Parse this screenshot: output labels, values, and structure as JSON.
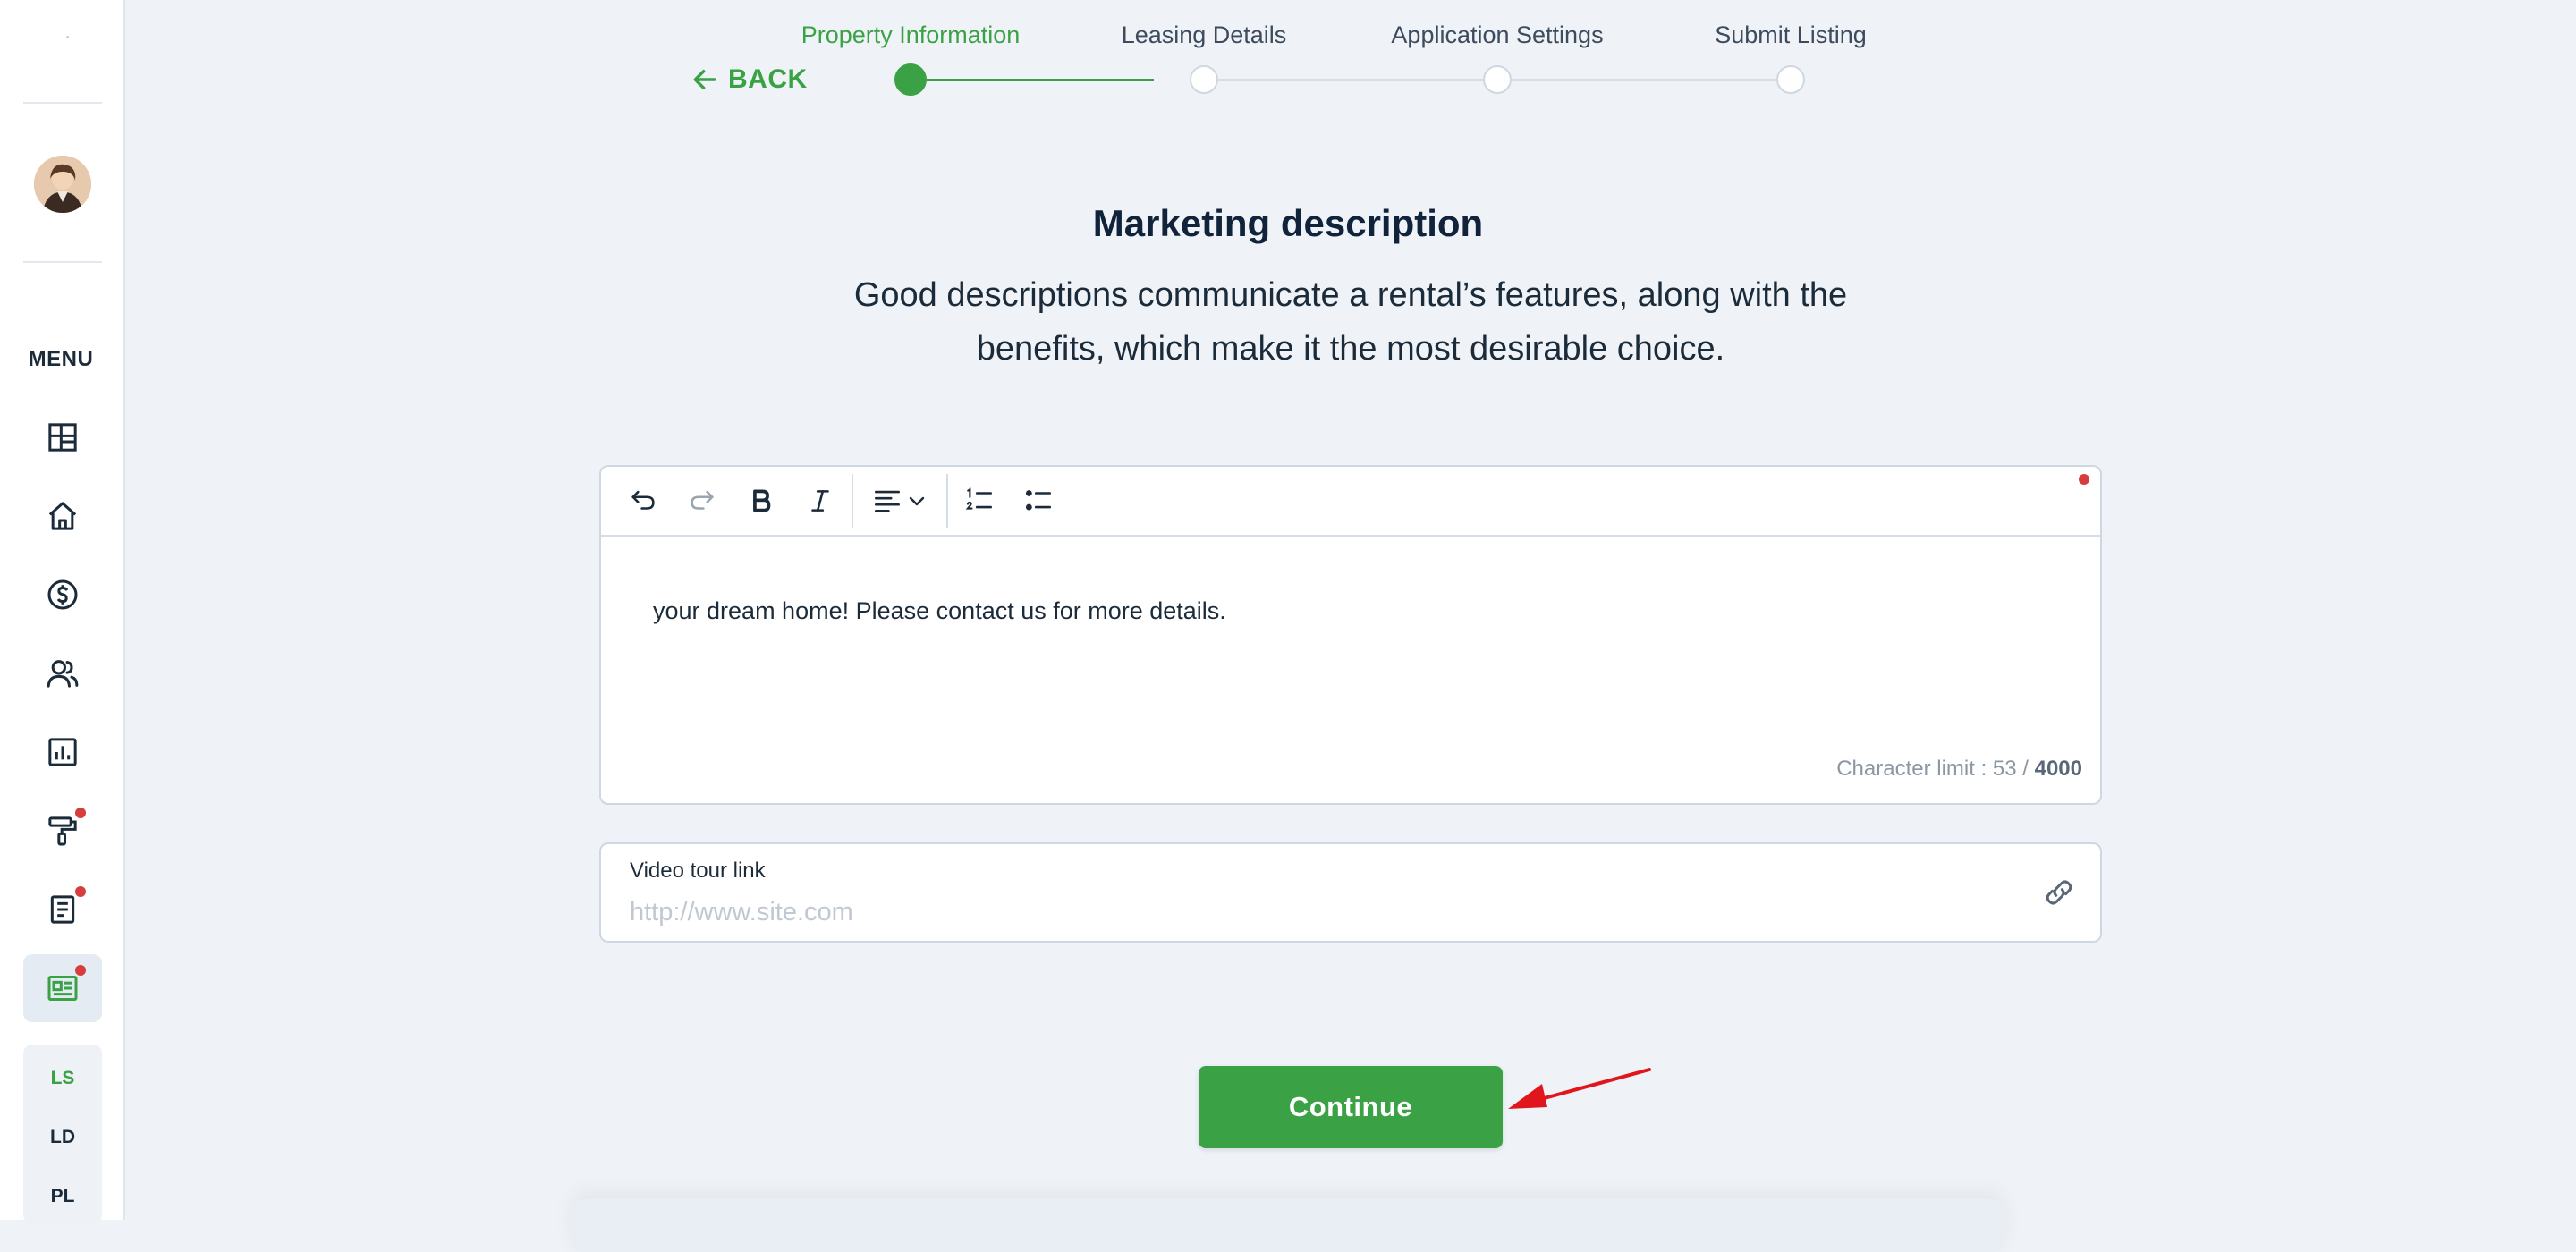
{
  "sidebar": {
    "menu_label": "MENU",
    "nav_icons": [
      "dashboard-icon",
      "home-icon",
      "dollar-icon",
      "users-icon",
      "chart-icon",
      "paint-roller-icon",
      "document-icon",
      "listing-icon"
    ],
    "sub_items": [
      {
        "label": "LS",
        "active": true
      },
      {
        "label": "LD",
        "active": false
      },
      {
        "label": "PL",
        "active": false
      }
    ]
  },
  "stepper": {
    "back_label": "BACK",
    "steps": [
      {
        "label": "Property Information",
        "state": "active"
      },
      {
        "label": "Leasing Details",
        "state": "pending"
      },
      {
        "label": "Application Settings",
        "state": "pending"
      },
      {
        "label": "Submit Listing",
        "state": "pending"
      }
    ]
  },
  "page": {
    "title": "Marketing description",
    "subtitle": "Good descriptions communicate a rental’s features, along with the benefits, which make it the most desirable choice."
  },
  "editor": {
    "toolbar": [
      "undo-icon",
      "redo-icon",
      "bold-icon",
      "italic-icon",
      "align-left-icon",
      "chevron-down-icon",
      "ordered-list-icon",
      "bullet-list-icon"
    ],
    "content": "your dream home! Please contact us for more details.",
    "char_limit_prefix": "Character limit : 53 / ",
    "char_limit_max": "4000"
  },
  "video": {
    "label": "Video tour link",
    "value": "",
    "placeholder": "http://www.site.com"
  },
  "actions": {
    "continue_label": "Continue"
  },
  "colors": {
    "accent": "#3aa244",
    "badge": "#d63d3d",
    "background": "#eff3f8",
    "text": "#1c2b3a"
  }
}
